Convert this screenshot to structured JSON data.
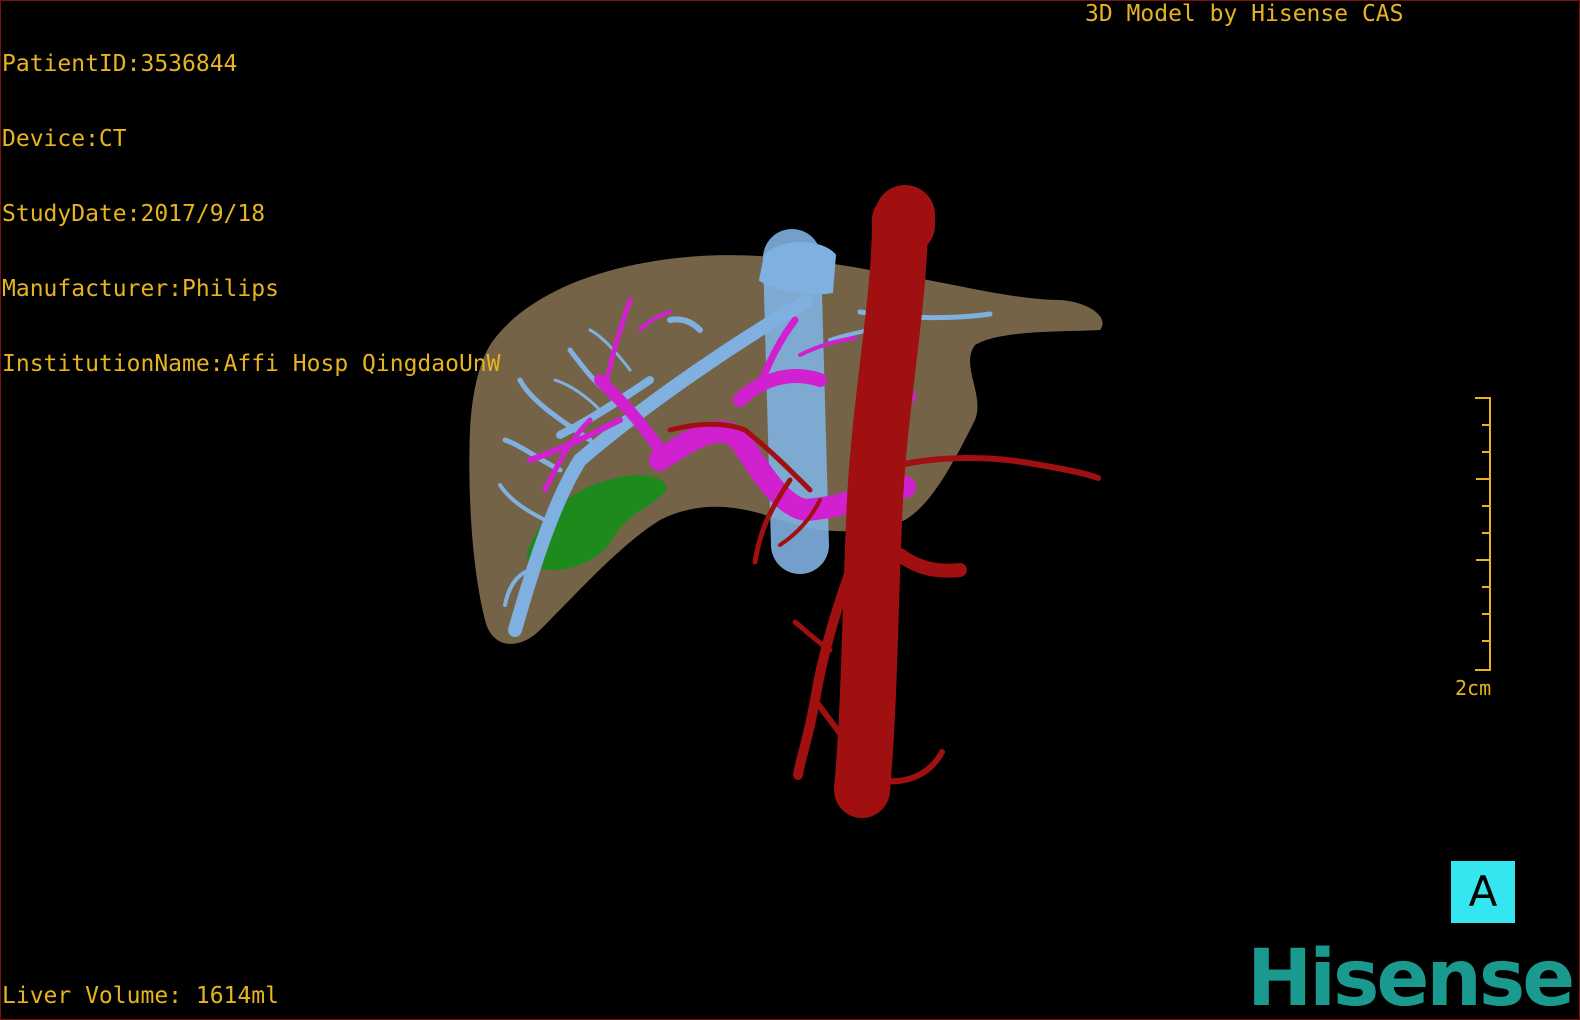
{
  "header": {
    "patient_id": "PatientID:3536844",
    "device": "Device:CT",
    "study_date": "StudyDate:2017/9/18",
    "manufacturer": "Manufacturer:Philips",
    "institution": "InstitutionName:Affi Hosp QingdaoUnW"
  },
  "credit": "3D Model by Hisense CAS",
  "liver_volume": "Liver Volume: 1614ml",
  "scale_label": "2cm",
  "orientation_label": "A",
  "brand": "Hisense",
  "colors": {
    "overlay_text": "#e6b420",
    "liver": "#8a7455",
    "hepatic_vein": "#7fb0e0",
    "portal_vein": "#d020d0",
    "artery": "#a01010",
    "gallbladder": "#1e8a1e",
    "orientation_badge": "#33e6f0",
    "brand": "#1a9a8e"
  }
}
